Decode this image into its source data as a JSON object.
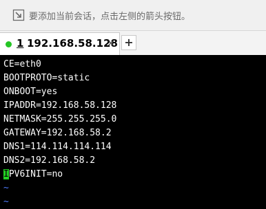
{
  "hint_bar": {
    "text": "要添加当前会话，点击左侧的箭头按钮。",
    "icon": "arrow-in-box-icon"
  },
  "tab": {
    "number": "1",
    "title": "192.168.58.128",
    "close_glyph": "×",
    "status_color": "#25c525"
  },
  "new_tab_glyph": "+",
  "terminal": {
    "lines": [
      "CE=eth0",
      "BOOTPROTO=static",
      "ONBOOT=yes",
      "IPADDR=192.168.58.128",
      "NETMASK=255.255.255.0",
      "GATEWAY=192.168.58.2",
      "DNS1=114.114.114.114",
      "DNS2=192.168.58.2"
    ],
    "cursor_line": {
      "cursor_char": "I",
      "rest": "PV6INIT=no"
    },
    "tilde_lines": [
      "~",
      "~"
    ],
    "cursor_color": "#24d024",
    "tilde_color": "#4f7cff"
  }
}
